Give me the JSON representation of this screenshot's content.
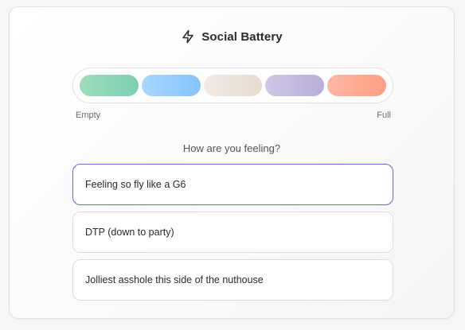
{
  "header": {
    "title": "Social Battery",
    "icon": "lightning-bolt-icon"
  },
  "battery": {
    "segments": [
      {
        "name": "segment-1",
        "color_start": "#9fdcbc",
        "color_end": "#7dcfb0"
      },
      {
        "name": "segment-2",
        "color_start": "#a9d8ff",
        "color_end": "#84c3fb"
      },
      {
        "name": "segment-3",
        "color_start": "#f2ebe4",
        "color_end": "#e6dbd0"
      },
      {
        "name": "segment-4",
        "color_start": "#cfc7e6",
        "color_end": "#b8aed8"
      },
      {
        "name": "segment-5",
        "color_start": "#ffb8a3",
        "color_end": "#ff9e86"
      }
    ],
    "min_label": "Empty",
    "max_label": "Full"
  },
  "question": {
    "prompt": "How are you feeling?",
    "options": [
      {
        "label": "Feeling so fly like a G6",
        "selected": true
      },
      {
        "label": "DTP (down to party)",
        "selected": false
      },
      {
        "label": "Jolliest asshole this side of the nuthouse",
        "selected": false
      }
    ]
  },
  "colors": {
    "accent": "#6f6fd8"
  }
}
